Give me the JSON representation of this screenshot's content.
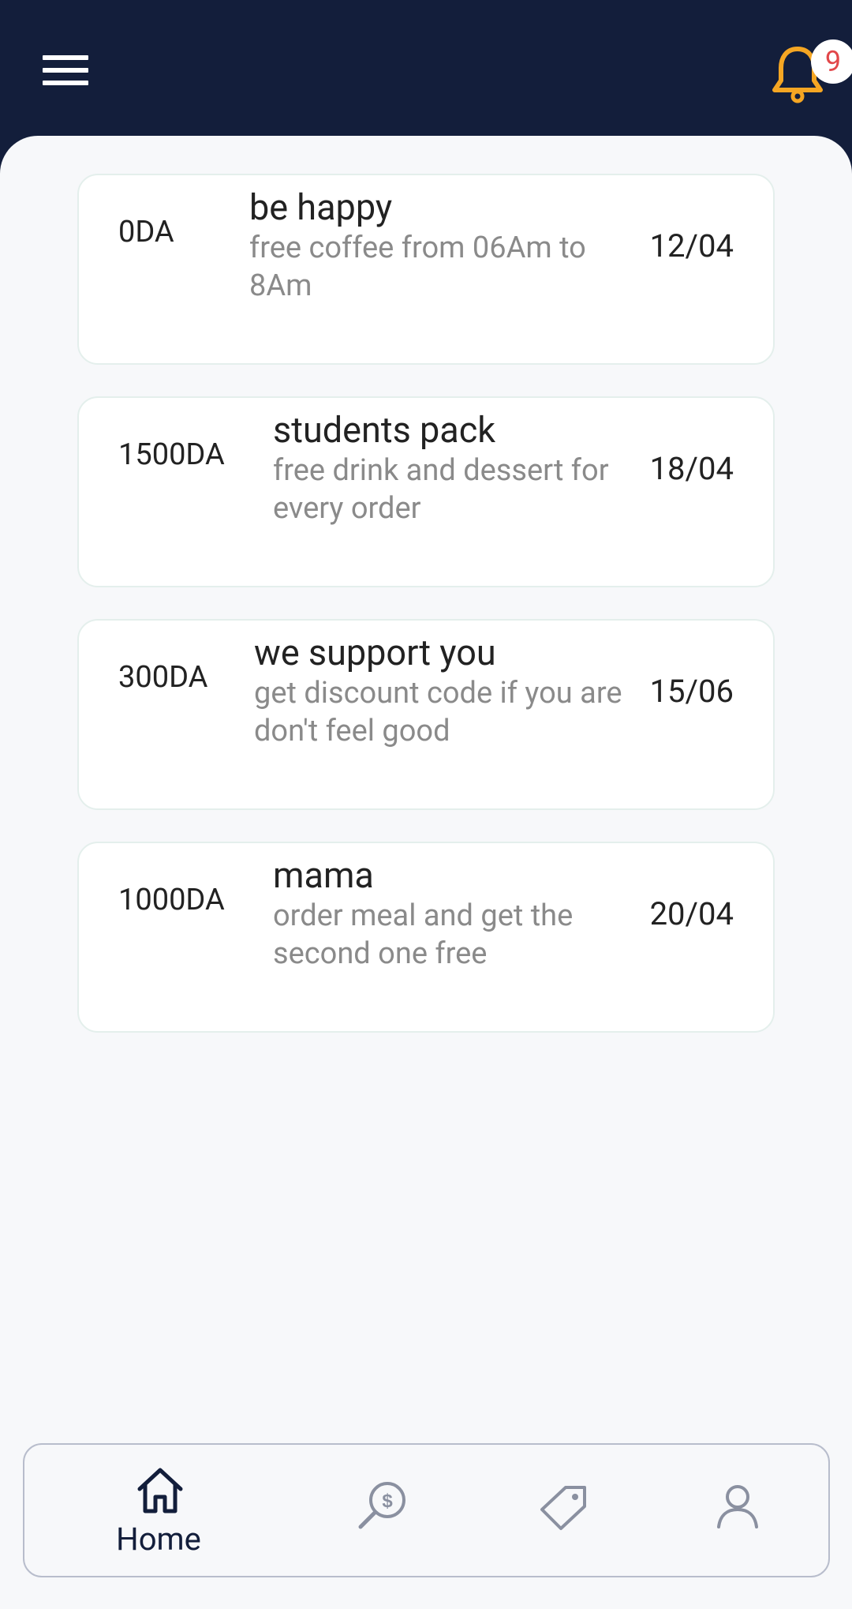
{
  "header": {
    "notification_count": "9"
  },
  "offers": [
    {
      "price": "0DA",
      "title": "be happy",
      "description": "free coffee from 06Am to 8Am",
      "date": "12/04"
    },
    {
      "price": "1500DA",
      "title": "students pack",
      "description": "free drink and dessert for every order",
      "date": "18/04"
    },
    {
      "price": "300DA",
      "title": "we support you",
      "description": "get discount code if you are don't feel good",
      "date": "15/06"
    },
    {
      "price": "1000DA",
      "title": "mama",
      "description": "order meal and get the second one free",
      "date": "20/04"
    }
  ],
  "bottom_nav": {
    "items": [
      {
        "label": "Home",
        "icon": "home-icon",
        "active": true
      },
      {
        "label": "",
        "icon": "search-money-icon",
        "active": false
      },
      {
        "label": "",
        "icon": "tag-icon",
        "active": false
      },
      {
        "label": "",
        "icon": "user-icon",
        "active": false
      }
    ]
  },
  "colors": {
    "header_bg": "#131e3b",
    "bell": "#f5a623",
    "badge_text": "#e2474a",
    "content_bg": "#f7f8fa"
  }
}
